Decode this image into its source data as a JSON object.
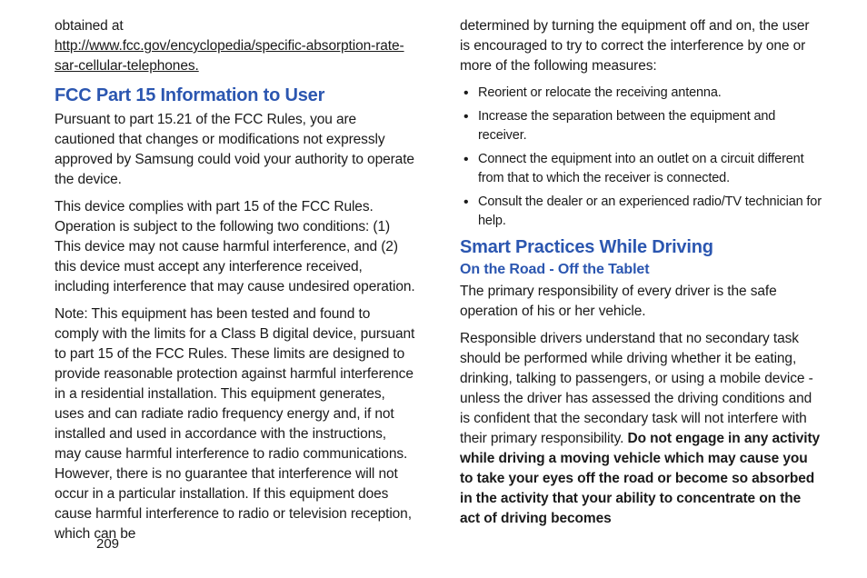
{
  "left": {
    "intro1": "obtained at",
    "link": "http://www.fcc.gov/encyclopedia/specific-absorption-rate-sar-cellular-telephones.",
    "h1": "FCC Part 15 Information to User",
    "p1": "Pursuant to part 15.21 of the FCC Rules, you are cautioned that changes or modifications not expressly approved by Samsung could void your authority to operate the device.",
    "p2": "This device complies with part 15 of the FCC Rules. Operation is subject to the following two conditions: (1) This device may not cause harmful interference, and (2) this device must accept any interference received, including interference that may cause undesired operation.",
    "p3": "Note: This equipment has been tested and found to comply with the limits for a Class B digital device, pursuant to part 15 of the FCC Rules. These limits are designed to provide reasonable protection against harmful interference in a residential installation. This equipment generates, uses and can radiate radio frequency energy and, if not installed and used in accordance with the instructions, may cause harmful interference to radio communications. However, there is no guarantee that interference will not occur in a particular installation. If this equipment does cause harmful interference to radio or television reception, which can be"
  },
  "right": {
    "p1": "determined by turning the equipment off and on, the user is encouraged to try to correct the interference by one or more of the following measures:",
    "bullets": [
      "Reorient or relocate the receiving antenna.",
      "Increase the separation between the equipment and receiver.",
      "Connect the equipment into an outlet on a circuit different from that to which the receiver is connected.",
      "Consult the dealer or an experienced radio/TV technician for help."
    ],
    "h1": "Smart Practices While Driving",
    "h2": "On the Road - Off the Tablet",
    "p2": "The primary responsibility of every driver is the safe operation of his or her vehicle.",
    "p3a": "Responsible drivers understand that no secondary task should be performed while driving whether it be eating, drinking, talking to passengers, or using a mobile device - unless the driver has assessed the driving conditions and is confident that the secondary task will not interfere with their primary responsibility. ",
    "p3b": "Do not engage in any activity while driving a moving vehicle which may cause you to take your eyes off the road or become so absorbed in the activity that your ability to concentrate on the act of driving becomes"
  },
  "pageno": "209"
}
